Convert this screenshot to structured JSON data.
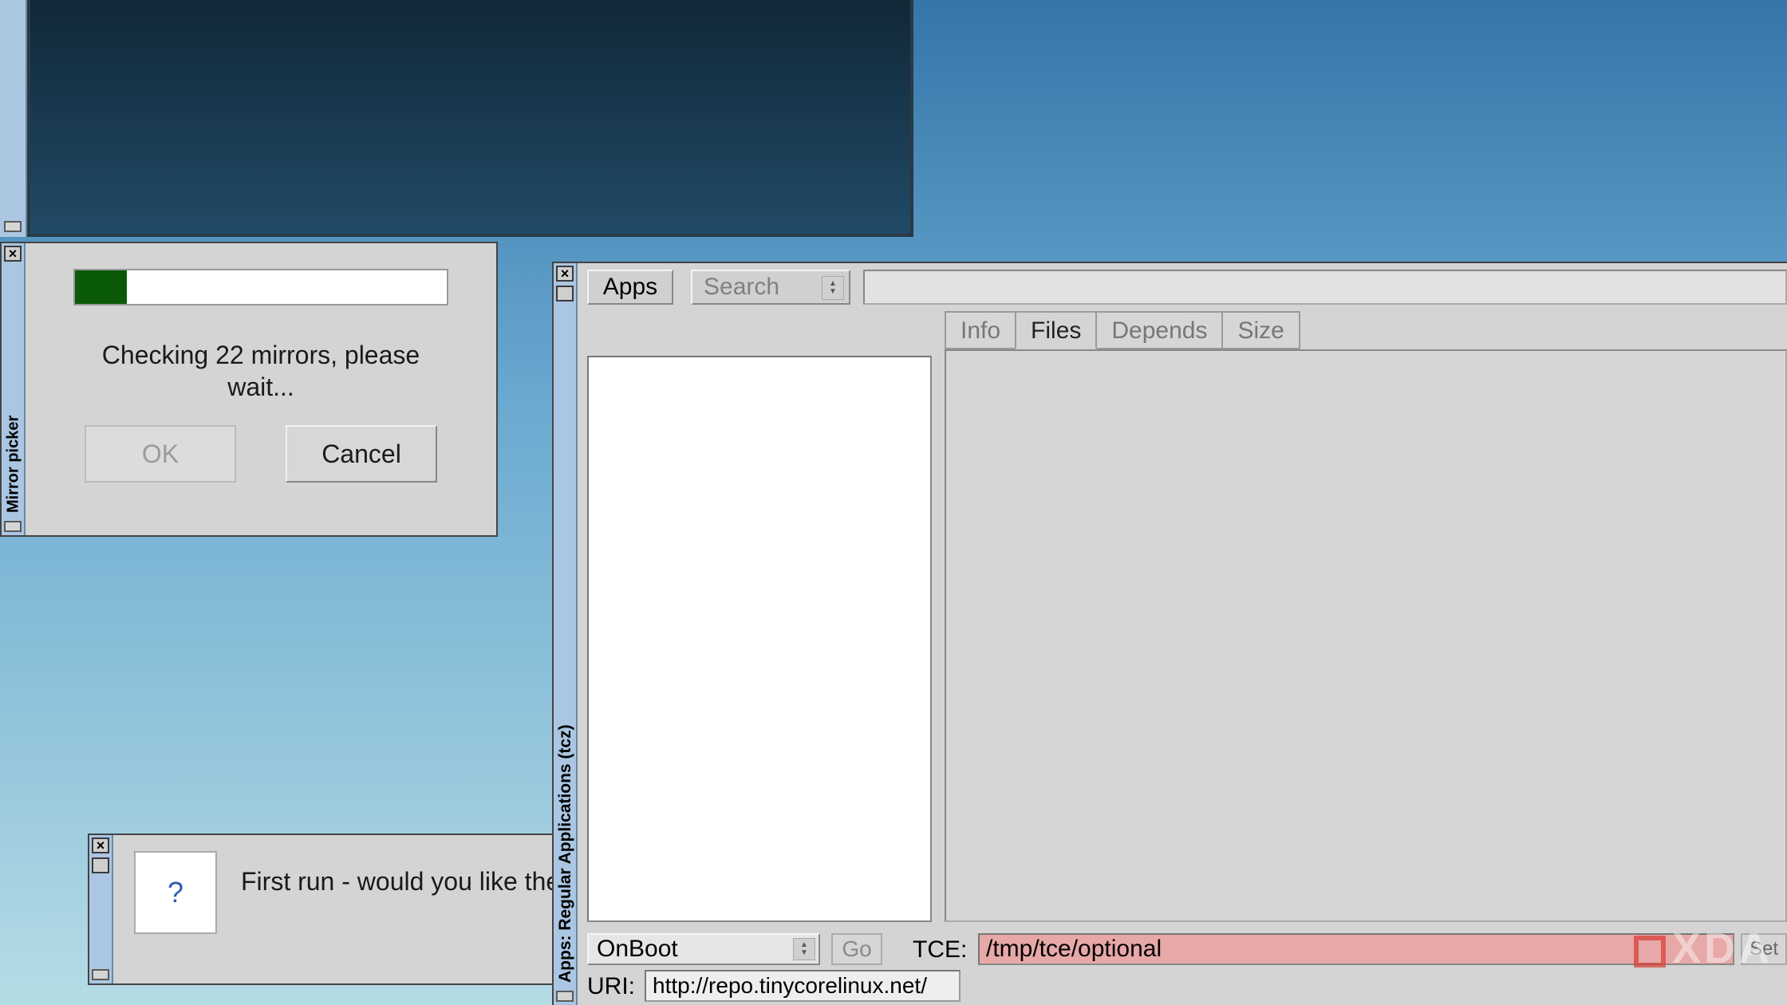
{
  "terminal": {
    "title": ""
  },
  "mirror_picker": {
    "title": "Mirror picker",
    "progress_percent": 14,
    "message": "Checking 22 mirrors, please\nwait...",
    "ok_label": "OK",
    "cancel_label": "Cancel"
  },
  "first_run": {
    "icon_glyph": "?",
    "message": "First run - would you like the"
  },
  "apps": {
    "title": "Apps: Regular Applications (tcz)",
    "apps_button": "Apps",
    "search_mode": "Search",
    "search_value": "",
    "tabs": [
      "Info",
      "Files",
      "Depends",
      "Size"
    ],
    "active_tab": "Files",
    "install_mode": "OnBoot",
    "go_label": "Go",
    "tce_label": "TCE:",
    "tce_path": "/tmp/tce/optional",
    "set_label": "Set",
    "uri_label": "URI:",
    "uri_value": "http://repo.tinycorelinux.net/"
  },
  "watermark": "XDA"
}
